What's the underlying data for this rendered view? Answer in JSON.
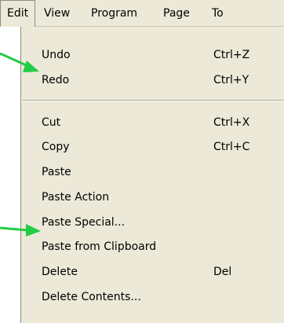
{
  "menubar": {
    "items": [
      {
        "label": "Edit",
        "active": true
      },
      {
        "label": "View"
      },
      {
        "label": "Program"
      },
      {
        "label": "Page"
      },
      {
        "label": "To"
      }
    ]
  },
  "edit_menu": {
    "items": [
      {
        "label": "Undo",
        "shortcut": "Ctrl+Z"
      },
      {
        "label": "Redo",
        "shortcut": "Ctrl+Y"
      },
      {
        "label": "Cut",
        "shortcut": "Ctrl+X"
      },
      {
        "label": "Copy",
        "shortcut": "Ctrl+C"
      },
      {
        "label": "Paste"
      },
      {
        "label": "Paste Action"
      },
      {
        "label": "Paste Special..."
      },
      {
        "label": "Paste from Clipboard"
      },
      {
        "label": "Delete",
        "shortcut": "Del"
      },
      {
        "label": "Delete Contents..."
      }
    ]
  },
  "colors": {
    "menu_background": "#ece9d8",
    "annotation_arrow": "#22cc44"
  }
}
